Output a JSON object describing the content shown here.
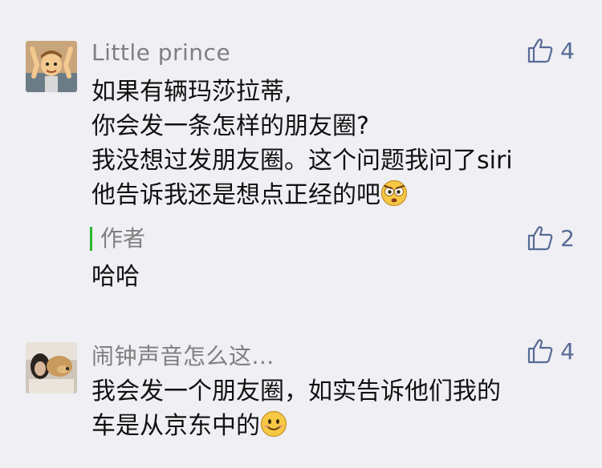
{
  "comments": [
    {
      "username": "Little prince",
      "likes": "4",
      "lines": [
        "如果有辆玛莎拉蒂,",
        "你会发一条怎样的朋友圈?",
        "我没想过发朋友圈。这个问题我问了siri",
        "他告诉我还是想点正经的吧"
      ],
      "emoji": "angry-eyes-emoji",
      "reply": {
        "author": "作者",
        "likes": "2",
        "text": "哈哈"
      }
    },
    {
      "username": "闹钟声音怎么这...",
      "likes": "4",
      "lines": [
        "我会发一个朋友圈，如实告诉他们我的",
        "车是从京东中的"
      ],
      "emoji": "smile-emoji"
    }
  ],
  "colors": {
    "background": "#efeff4",
    "name": "#7f7f7f",
    "link_blue": "#576b95",
    "author_bar": "#2fb52f"
  },
  "icons": {
    "like": "thumbs-up-icon"
  }
}
